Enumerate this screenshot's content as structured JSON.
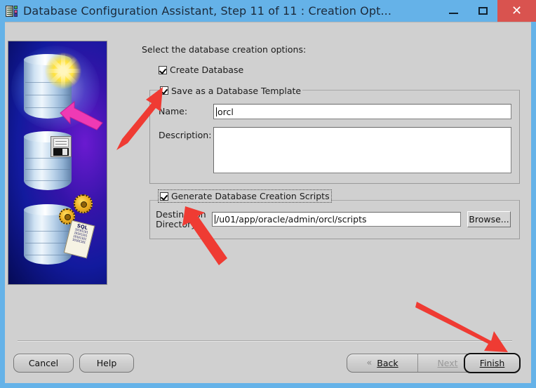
{
  "window": {
    "title": "Database Configuration Assistant, Step 11 of 11 : Creation Opt...",
    "icon": "database-chip-icon",
    "minimize_label": "–",
    "maximize_label": "□",
    "close_label": "✕",
    "accent_titlebar": "#65b2e8",
    "close_button_color": "#d9534f",
    "client_background": "#d0d0d0"
  },
  "banner": {
    "name": "oracle-database-creation-banner",
    "elements": [
      "database-cylinder-star",
      "magenta-arrow",
      "database-cylinder-floppy",
      "database-cylinder-gears",
      "sql-scroll"
    ],
    "sql_label": "SQL",
    "bits": [
      "10101101",
      "10101101",
      "10101101",
      "10101101"
    ]
  },
  "main": {
    "intro": "Select the database creation options:",
    "create_database": {
      "label": "Create Database",
      "checked": true
    },
    "template_group": {
      "title": "Save as a Database Template",
      "checked": true,
      "name_label": "Name:",
      "name_value": "orcl",
      "description_label": "Description:",
      "description_value": ""
    },
    "scripts_group": {
      "title": "Generate Database Creation Scripts",
      "checked": true,
      "destination_label_line1": "Destination",
      "destination_label_line2": "Directory:",
      "destination_value": "/u01/app/oracle/admin/orcl/scripts",
      "browse_label": "Browse..."
    }
  },
  "footer": {
    "cancel_label": "Cancel",
    "help_label": "Help",
    "back_label": "Back",
    "back_mnemonic": "B",
    "back_chevron": "«",
    "next_label": "Next",
    "next_mnemonic": "N",
    "next_chevron": "»",
    "next_disabled": true,
    "finish_label": "Finish",
    "finish_mnemonic": "F",
    "finish_is_default": true
  },
  "annotations": {
    "color": "#ef3b33",
    "arrows": [
      {
        "name": "arrow-to-save-template-checkbox",
        "target": "Save as a Database Template checkbox"
      },
      {
        "name": "arrow-to-destination-directory",
        "target": "Destination Directory field"
      },
      {
        "name": "arrow-to-finish-button",
        "target": "Finish button"
      }
    ]
  }
}
